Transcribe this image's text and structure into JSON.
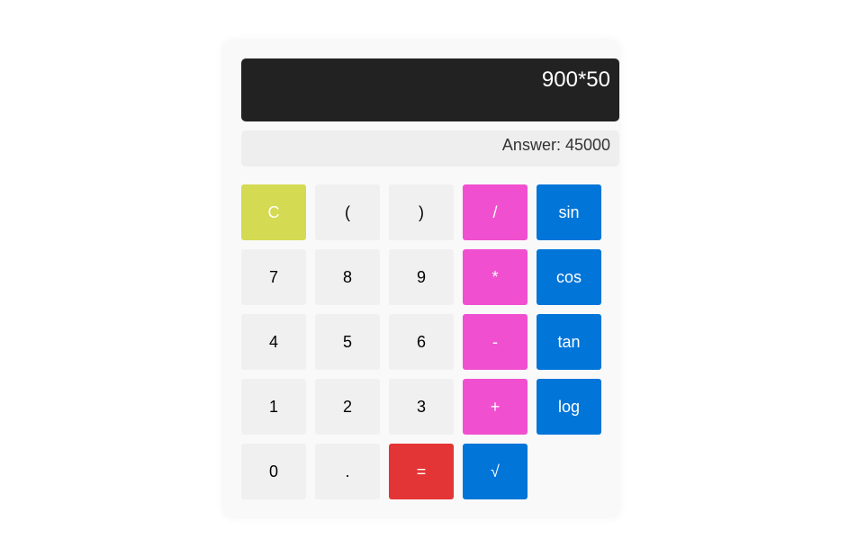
{
  "display": {
    "expression": "900*50",
    "answer": "Answer: 45000"
  },
  "colors": {
    "clear": "#d4da52",
    "number": "#f0f0f0",
    "operator": "#f050cf",
    "function": "#0275d8",
    "equals": "#e33535"
  },
  "keys": [
    {
      "label": "C",
      "kind": "clear",
      "name": "clear-button"
    },
    {
      "label": "(",
      "kind": "number",
      "name": "open-paren-button"
    },
    {
      "label": ")",
      "kind": "number",
      "name": "close-paren-button"
    },
    {
      "label": "/",
      "kind": "operator",
      "name": "divide-button"
    },
    {
      "label": "sin",
      "kind": "function",
      "name": "sin-button"
    },
    {
      "label": "7",
      "kind": "number",
      "name": "digit-7-button"
    },
    {
      "label": "8",
      "kind": "number",
      "name": "digit-8-button"
    },
    {
      "label": "9",
      "kind": "number",
      "name": "digit-9-button"
    },
    {
      "label": "*",
      "kind": "operator",
      "name": "multiply-button"
    },
    {
      "label": "cos",
      "kind": "function",
      "name": "cos-button"
    },
    {
      "label": "4",
      "kind": "number",
      "name": "digit-4-button"
    },
    {
      "label": "5",
      "kind": "number",
      "name": "digit-5-button"
    },
    {
      "label": "6",
      "kind": "number",
      "name": "digit-6-button"
    },
    {
      "label": "-",
      "kind": "operator",
      "name": "subtract-button"
    },
    {
      "label": "tan",
      "kind": "function",
      "name": "tan-button"
    },
    {
      "label": "1",
      "kind": "number",
      "name": "digit-1-button"
    },
    {
      "label": "2",
      "kind": "number",
      "name": "digit-2-button"
    },
    {
      "label": "3",
      "kind": "number",
      "name": "digit-3-button"
    },
    {
      "label": "+",
      "kind": "operator",
      "name": "add-button"
    },
    {
      "label": "log",
      "kind": "function",
      "name": "log-button"
    },
    {
      "label": "0",
      "kind": "number",
      "name": "digit-0-button"
    },
    {
      "label": ".",
      "kind": "number",
      "name": "decimal-button"
    },
    {
      "label": "=",
      "kind": "equals",
      "name": "equals-button"
    },
    {
      "label": "√",
      "kind": "function",
      "name": "sqrt-button"
    }
  ]
}
